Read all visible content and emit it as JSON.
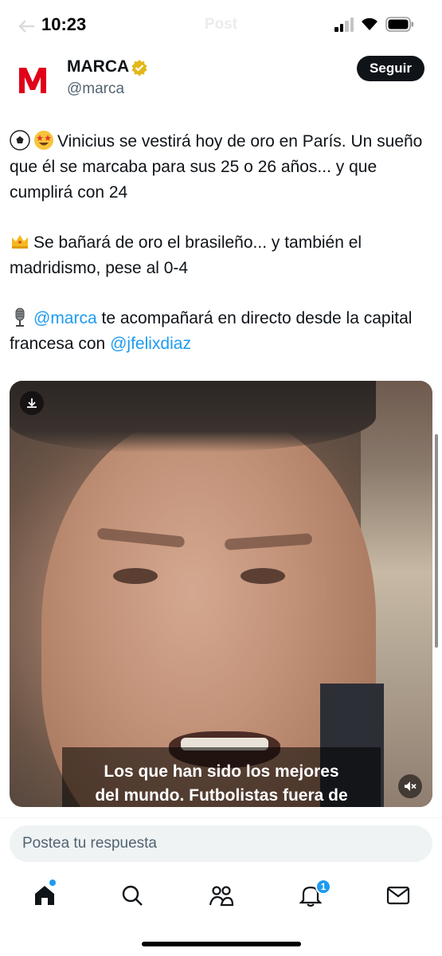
{
  "status_bar": {
    "time": "10:23",
    "header_title": "Post"
  },
  "tweet": {
    "author": {
      "name": "MARCA",
      "handle": "@marca",
      "verified": true,
      "avatar_icon": "marca-logo",
      "avatar_letter": "M",
      "avatar_color": "#e1001a"
    },
    "follow_label": "Seguir",
    "paragraphs": [
      {
        "emojis": [
          "soccer-ball",
          "star-struck"
        ],
        "text": "Vinicius se vestirá hoy de oro en París. Un sueño que él se marcaba para sus 25 o 26 años... y que cumplirá con 24"
      },
      {
        "emojis": [
          "crown"
        ],
        "text": "Se bañará de oro el brasileño... y también el madridismo, pese al 0-4"
      },
      {
        "emojis": [
          "microphone"
        ],
        "mention_1": "@marca",
        "text_1": "te acompañará en directo desde la capital francesa con",
        "mention_2": "@jfelixdiaz"
      }
    ],
    "video": {
      "subtitle_line_1": "Los que han sido los mejores",
      "subtitle_line_2": "del mundo. Futbolistas fuera de",
      "download_icon": "download-icon",
      "mute_icon": "speaker-muted-icon"
    }
  },
  "reply": {
    "placeholder": "Postea tu respuesta"
  },
  "bottom_nav": {
    "items": [
      "home-icon",
      "search-icon",
      "communities-icon",
      "notifications-icon",
      "messages-icon"
    ],
    "notification_count": "1"
  },
  "colors": {
    "accent": "#1d9bf0",
    "text": "#0f1419",
    "secondary_text": "#536471",
    "verified_gold": "#e2b719"
  }
}
